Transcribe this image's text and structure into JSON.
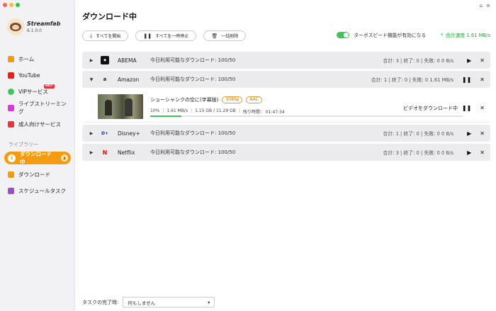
{
  "app": {
    "name": "Streamfab",
    "version": "6.1.0.0"
  },
  "sidebar": {
    "items": [
      {
        "label": "ホーム",
        "color": "#f39c12"
      },
      {
        "label": "YouTube",
        "color": "#e62117"
      },
      {
        "label": "VIPサービス",
        "color": "#3ec45b",
        "badge": "HOT"
      },
      {
        "label": "ライブストリーミング",
        "color": "#d63ad6"
      },
      {
        "label": "成人向けサービス",
        "color": "#e8353b"
      }
    ],
    "library_label": "ライブラリー",
    "library_items": [
      {
        "label": "ダウンロード中",
        "active": true
      },
      {
        "label": "ダウンロード",
        "color": "#f39c12"
      },
      {
        "label": "スケジュールタスク",
        "color": "#9b4dca"
      }
    ]
  },
  "header": {
    "title": "ダウンロード中"
  },
  "toolbar": {
    "start_all": "すべてを開始",
    "pause_all": "すべてを一時停止",
    "delete_all": "一括削除",
    "turbo_label": "ターボスピード機能が有効になる",
    "total_speed": "合計速度 1.61 MB/s"
  },
  "rows": [
    {
      "service": "ABEMA",
      "available": "今日利用可能なダウンロード: 100/50",
      "stats": "合計: 3 | 終了: 0 | 失敗: 0 0 B/s",
      "expanded": false
    },
    {
      "service": "Amazon",
      "available": "今日利用可能なダウンロード: 100/50",
      "stats": "合計: 1 | 終了: 0 | 失敗: 0 1.61 MB/s",
      "expanded": true
    },
    {
      "service": "Disney+",
      "available": "今日利用可能なダウンロード: 100/50",
      "stats": "合計: 1 | 終了: 0 | 失敗: 0 0 B/s",
      "expanded": false
    },
    {
      "service": "Netflix",
      "available": "今日利用可能なダウンロード: 100/50",
      "stats": "合計: 3 | 終了: 0 | 失敗: 0 0 B/s",
      "expanded": false
    }
  ],
  "task": {
    "title": "ショーシャンクの空に(字幕版)",
    "quality": "1080p",
    "audio": "AAC",
    "percent": "10%",
    "speed": "1.61 MB/s",
    "size": "1.15 GB / 11.29 GB",
    "remaining": "残り時間： 01:47:34",
    "progress": 0.1,
    "status": "ビデオをダウンロード中"
  },
  "footer": {
    "label": "タスクの完了時:",
    "value": "何もしません"
  }
}
